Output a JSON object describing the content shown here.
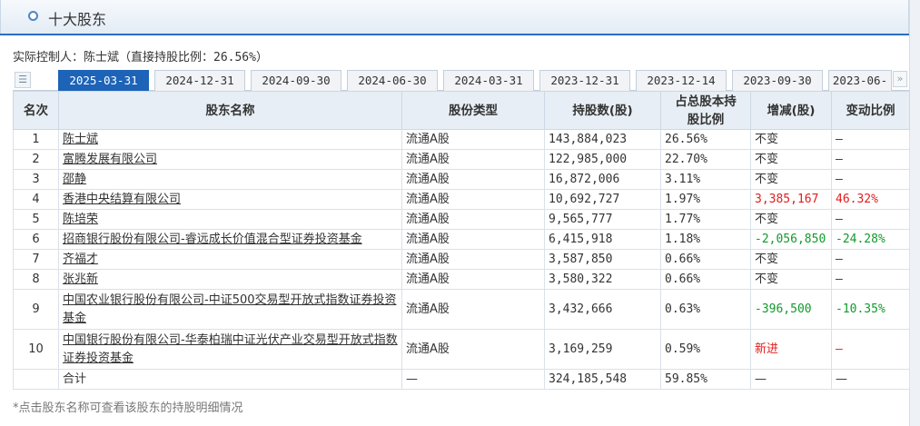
{
  "panel": {
    "title": "十大股东"
  },
  "controller": {
    "text": "实际控制人：陈士斌（直接持股比例：26.56%）"
  },
  "tabs": [
    {
      "label": "2025-03-31",
      "active": true
    },
    {
      "label": "2024-12-31"
    },
    {
      "label": "2024-09-30"
    },
    {
      "label": "2024-06-30"
    },
    {
      "label": "2024-03-31"
    },
    {
      "label": "2023-12-31"
    },
    {
      "label": "2023-12-14"
    },
    {
      "label": "2023-09-30"
    },
    {
      "label": "2023-06-"
    }
  ],
  "table": {
    "headers": {
      "rank": "名次",
      "name": "股东名称",
      "type": "股份类型",
      "shares": "持股数(股)",
      "ratio": "占总股本持股比例",
      "change": "增减(股)",
      "change_ratio": "变动比例"
    },
    "rows": [
      {
        "rank": "1",
        "name": "陈士斌",
        "type": "流通A股",
        "shares": "143,884,023",
        "ratio": "26.56%",
        "change": "不变",
        "change_ratio": "—"
      },
      {
        "rank": "2",
        "name": "富腾发展有限公司",
        "type": "流通A股",
        "shares": "122,985,000",
        "ratio": "22.70%",
        "change": "不变",
        "change_ratio": "—"
      },
      {
        "rank": "3",
        "name": "邵静",
        "type": "流通A股",
        "shares": "16,872,006",
        "ratio": "3.11%",
        "change": "不变",
        "change_ratio": "—"
      },
      {
        "rank": "4",
        "name": "香港中央结算有限公司",
        "type": "流通A股",
        "shares": "10,692,727",
        "ratio": "1.97%",
        "change": "3,385,167",
        "change_ratio": "46.32%",
        "trend": "up"
      },
      {
        "rank": "5",
        "name": "陈培荣",
        "type": "流通A股",
        "shares": "9,565,777",
        "ratio": "1.77%",
        "change": "不变",
        "change_ratio": "—"
      },
      {
        "rank": "6",
        "name": "招商银行股份有限公司-睿远成长价值混合型证券投资基金",
        "type": "流通A股",
        "shares": "6,415,918",
        "ratio": "1.18%",
        "change": "-2,056,850",
        "change_ratio": "-24.28%",
        "trend": "down"
      },
      {
        "rank": "7",
        "name": "齐福才",
        "type": "流通A股",
        "shares": "3,587,850",
        "ratio": "0.66%",
        "change": "不变",
        "change_ratio": "—"
      },
      {
        "rank": "8",
        "name": "张兆新",
        "type": "流通A股",
        "shares": "3,580,322",
        "ratio": "0.66%",
        "change": "不变",
        "change_ratio": "—"
      },
      {
        "rank": "9",
        "name": "中国农业银行股份有限公司-中证500交易型开放式指数证券投资基金",
        "type": "流通A股",
        "shares": "3,432,666",
        "ratio": "0.63%",
        "change": "-396,500",
        "change_ratio": "-10.35%",
        "trend": "down",
        "tall": true
      },
      {
        "rank": "10",
        "name": "中国银行股份有限公司-华泰柏瑞中证光伏产业交易型开放式指数证券投资基金",
        "type": "流通A股",
        "shares": "3,169,259",
        "ratio": "0.59%",
        "change": "新进",
        "change_ratio": "—",
        "trend": "up",
        "tall": true
      }
    ],
    "total": {
      "label": "合计",
      "type": "—",
      "shares": "324,185,548",
      "ratio": "59.85%",
      "change": "—",
      "change_ratio": "—"
    }
  },
  "footnote": "*点击股东名称可查看该股东的持股明细情况",
  "colors": {
    "accent": "#1d63b8",
    "up": "#e31c1c",
    "down": "#119a2b"
  }
}
